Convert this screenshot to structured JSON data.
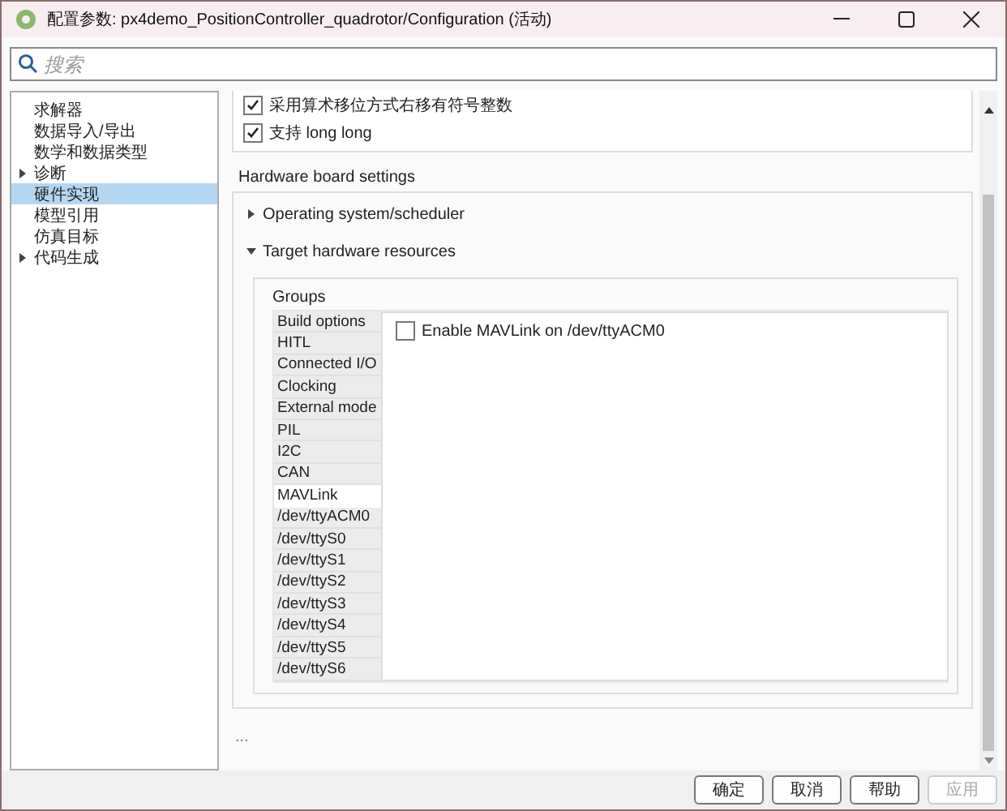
{
  "window": {
    "title": "配置参数: px4demo_PositionController_quadrotor/Configuration (活动)"
  },
  "search": {
    "placeholder": "搜索"
  },
  "tree": [
    {
      "label": "求解器",
      "kind": "leaf",
      "selected": false
    },
    {
      "label": "数据导入/导出",
      "kind": "leaf",
      "selected": false
    },
    {
      "label": "数学和数据类型",
      "kind": "leaf",
      "selected": false
    },
    {
      "label": "诊断",
      "kind": "collapsed",
      "selected": false
    },
    {
      "label": "硬件实现",
      "kind": "leaf",
      "selected": true
    },
    {
      "label": "模型引用",
      "kind": "leaf",
      "selected": false
    },
    {
      "label": "仿真目标",
      "kind": "leaf",
      "selected": false
    },
    {
      "label": "代码生成",
      "kind": "collapsed",
      "selected": false
    }
  ],
  "options": [
    {
      "label": "采用算术移位方式右移有符号整数",
      "checked": true
    },
    {
      "label": "支持 long long",
      "checked": true
    }
  ],
  "hardware": {
    "heading": "Hardware board settings",
    "sections": [
      {
        "label": "Operating system/scheduler",
        "expanded": false
      },
      {
        "label": "Target hardware resources",
        "expanded": true
      }
    ],
    "groups_label": "Groups",
    "groups": [
      {
        "label": "Build options",
        "selected": false
      },
      {
        "label": "HITL",
        "selected": false
      },
      {
        "label": "Connected I/O",
        "selected": false
      },
      {
        "label": "Clocking",
        "selected": false
      },
      {
        "label": "External mode",
        "selected": false
      },
      {
        "label": "PIL",
        "selected": false
      },
      {
        "label": "I2C",
        "selected": false
      },
      {
        "label": "CAN",
        "selected": false
      },
      {
        "label": "MAVLink",
        "selected": true
      },
      {
        "label": "/dev/ttyACM0",
        "selected": false
      },
      {
        "label": "/dev/ttyS0",
        "selected": false
      },
      {
        "label": "/dev/ttyS1",
        "selected": false
      },
      {
        "label": "/dev/ttyS2",
        "selected": false
      },
      {
        "label": "/dev/ttyS3",
        "selected": false
      },
      {
        "label": "/dev/ttyS4",
        "selected": false
      },
      {
        "label": "/dev/ttyS5",
        "selected": false
      },
      {
        "label": "/dev/ttyS6",
        "selected": false
      }
    ],
    "group_options": [
      {
        "label": "Enable MAVLink on /dev/ttyACM0",
        "checked": false
      }
    ]
  },
  "more": "...",
  "buttons": [
    {
      "label": "确定",
      "disabled": false
    },
    {
      "label": "取消",
      "disabled": false
    },
    {
      "label": "帮助",
      "disabled": false
    },
    {
      "label": "应用",
      "disabled": true
    }
  ]
}
